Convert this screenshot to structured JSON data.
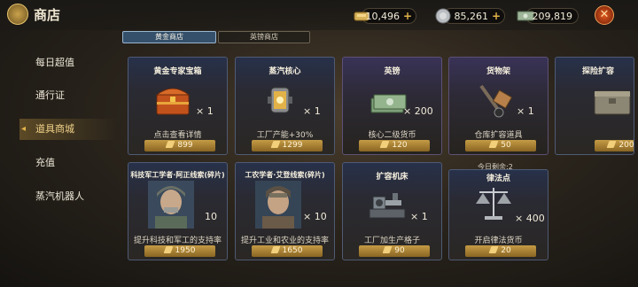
{
  "header": {
    "title": "商店"
  },
  "resources": [
    {
      "value": "10,496",
      "icon": "gold-bar-icon"
    },
    {
      "value": "85,261",
      "icon": "silver-coin-icon"
    },
    {
      "value": "209,819",
      "icon": "banknote-icon"
    }
  ],
  "sidebar": {
    "items": [
      {
        "label": "每日超值"
      },
      {
        "label": "通行证"
      },
      {
        "label": "道具商城",
        "active": true
      },
      {
        "label": "充值"
      },
      {
        "label": "蒸汽机器人"
      }
    ]
  },
  "tabs": [
    {
      "label": "黄金商店",
      "active": true
    },
    {
      "label": "英镑商店"
    }
  ],
  "cards": [
    {
      "name": "黄金专家宝箱",
      "qty": "× 1",
      "desc": "点击查看详情",
      "price": "899",
      "icon": "treasure-chest-icon"
    },
    {
      "name": "蒸汽核心",
      "qty": "× 1",
      "desc": "工厂产能+30%",
      "price": "1299",
      "icon": "steam-core-icon"
    },
    {
      "name": "英镑",
      "qty": "× 200",
      "desc": "核心二级货币",
      "price": "120",
      "icon": "pound-notes-icon"
    },
    {
      "name": "货物架",
      "qty": "× 1",
      "desc": "仓库扩容道具",
      "price": "50",
      "icon": "hand-truck-icon"
    },
    {
      "name": "探险扩容",
      "qty": "",
      "desc": "",
      "price": "200",
      "icon": "expedition-crate-icon"
    },
    {
      "name": "科技军工学者·阿正线索(碎片)",
      "qty": "10",
      "desc": "提升科技和军工的支持率",
      "price": "1950",
      "icon": "scholar-portrait-icon"
    },
    {
      "name": "工农学者·艾登线索(碎片)",
      "qty": "× 10",
      "desc": "提升工业和农业的支持率",
      "price": "1650",
      "icon": "scholar-portrait-icon"
    },
    {
      "name": "扩容机床",
      "qty": "× 1",
      "desc": "工厂加生产格子",
      "price": "90",
      "icon": "lathe-machine-icon"
    },
    {
      "name": "律法点",
      "qty": "× 400",
      "desc": "开启律法货币",
      "price": "20",
      "icon": "scales-icon"
    }
  ],
  "remaining_today": "今日剩余:2",
  "colors": {
    "gold_accent": "#e3b34a",
    "active_tab": "#35506a",
    "price_bar": "#b08835"
  }
}
